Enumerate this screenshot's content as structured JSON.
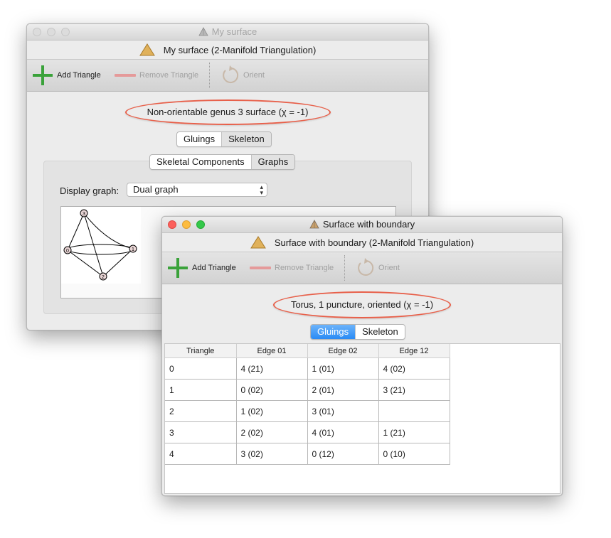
{
  "window1": {
    "title": "My surface",
    "header": "My surface (2-Manifold Triangulation)",
    "toolbar": {
      "add": "Add Triangle",
      "remove": "Remove Triangle",
      "orient": "Orient"
    },
    "status": "Non-orientable genus 3 surface (χ = -1)",
    "tabs": [
      "Gluings",
      "Skeleton"
    ],
    "selected_tab": "Skeleton",
    "subtabs": [
      "Skeletal Components",
      "Graphs"
    ],
    "selected_subtab": "Graphs",
    "display_graph_label": "Display graph:",
    "display_graph_value": "Dual graph",
    "graph_nodes": [
      "0",
      "1",
      "2",
      "3"
    ]
  },
  "window2": {
    "title": "Surface with boundary",
    "header": "Surface with boundary (2-Manifold Triangulation)",
    "toolbar": {
      "add": "Add Triangle",
      "remove": "Remove Triangle",
      "orient": "Orient"
    },
    "status": "Torus, 1 puncture, oriented (χ = -1)",
    "tabs": [
      "Gluings",
      "Skeleton"
    ],
    "selected_tab": "Gluings",
    "table": {
      "headers": [
        "Triangle",
        "Edge 01",
        "Edge 02",
        "Edge 12"
      ],
      "rows": [
        [
          "0",
          "4 (21)",
          "1 (01)",
          "4 (02)"
        ],
        [
          "1",
          "0 (02)",
          "2 (01)",
          "3 (21)"
        ],
        [
          "2",
          "1 (02)",
          "3 (01)",
          ""
        ],
        [
          "3",
          "2 (02)",
          "4 (01)",
          "1 (21)"
        ],
        [
          "4",
          "3 (02)",
          "0 (12)",
          "0 (10)"
        ]
      ]
    }
  },
  "colors": {
    "add_icon": "#3aa23a",
    "remove_icon": "#e59a9a",
    "highlight_oval": "#e8604a",
    "selected_tab_blue": "#2a8bf5",
    "triangle_icon": "#e0b15a"
  }
}
